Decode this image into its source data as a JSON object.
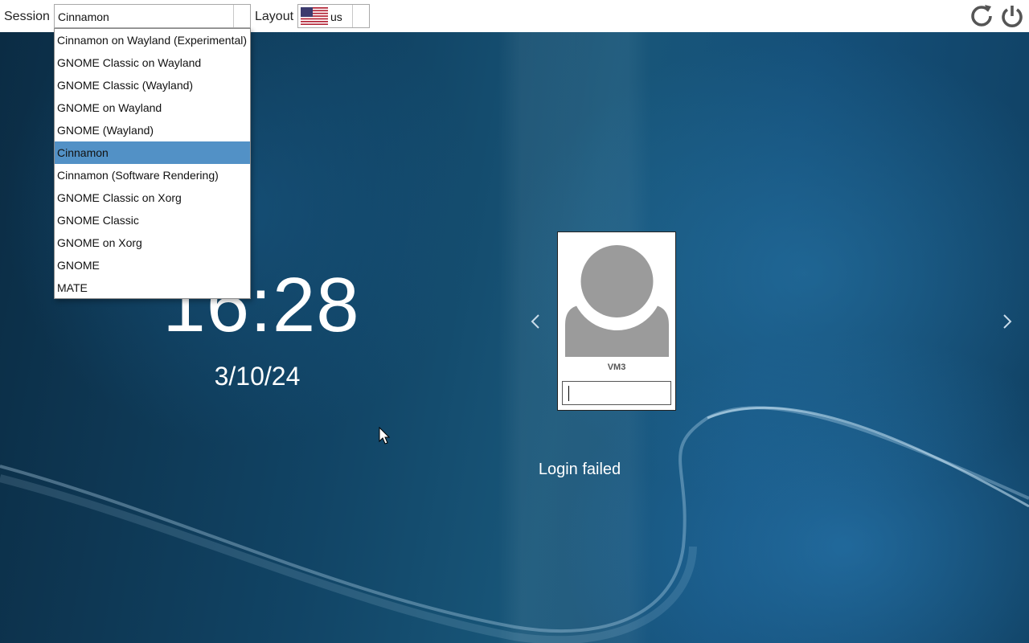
{
  "topbar": {
    "session_label": "Session",
    "session_value": "Cinnamon",
    "layout_label": "Layout",
    "layout_value": "us",
    "layout_flag": "us-flag-icon",
    "restart_icon": "restart-icon",
    "power_icon": "power-icon"
  },
  "session_dropdown": {
    "selected": "Cinnamon",
    "options": [
      "Cinnamon on Wayland (Experimental)",
      "GNOME Classic on Wayland",
      "GNOME Classic (Wayland)",
      "GNOME on Wayland",
      "GNOME (Wayland)",
      "Cinnamon",
      "Cinnamon (Software Rendering)",
      "GNOME Classic on Xorg",
      "GNOME Classic",
      "GNOME on Xorg",
      "GNOME",
      "MATE"
    ]
  },
  "clock": {
    "time": "16:28",
    "date": "3/10/24"
  },
  "user_card": {
    "username": "VM3",
    "password_value": "",
    "avatar_icon": "user-avatar-icon"
  },
  "navigation": {
    "prev_icon": "chevron-left-icon",
    "next_icon": "chevron-right-icon"
  },
  "status_message": "Login failed",
  "colors": {
    "topbar_bg": "#ffffff",
    "selected_option_bg": "#5291c6",
    "background_dark": "#0b2c44",
    "background_mid": "#185679",
    "avatar_gray": "#9b9b9b"
  }
}
